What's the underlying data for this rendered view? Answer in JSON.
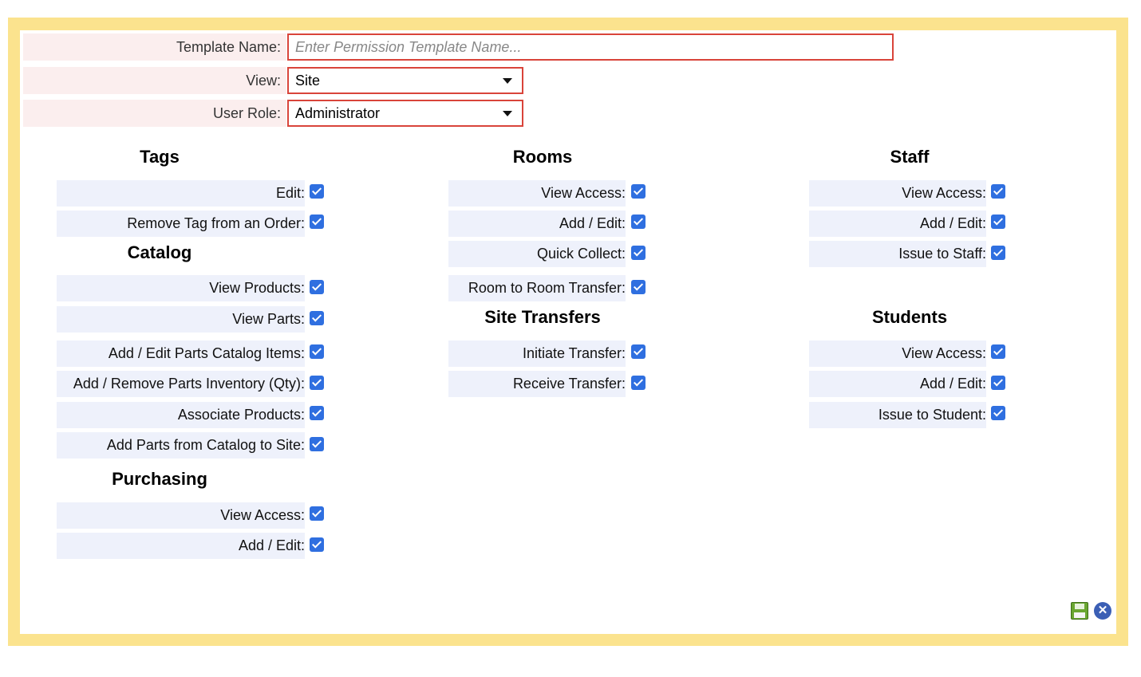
{
  "form": {
    "template_name": {
      "label": "Template Name:",
      "placeholder": "Enter Permission Template Name...",
      "value": ""
    },
    "view": {
      "label": "View:",
      "value": "Site"
    },
    "user_role": {
      "label": "User Role:",
      "value": "Administrator"
    }
  },
  "sections": {
    "tags": {
      "title": "Tags",
      "items": [
        {
          "label": "Edit:",
          "checked": true
        },
        {
          "label": "Remove Tag from an Order:",
          "checked": true
        }
      ]
    },
    "catalog": {
      "title": "Catalog",
      "items": [
        {
          "label": "View Products:",
          "checked": true
        },
        {
          "label": "View Parts:",
          "checked": true
        },
        {
          "label": "Add / Edit Parts Catalog Items:",
          "checked": true
        },
        {
          "label": "Add / Remove Parts Inventory (Qty):",
          "checked": true
        },
        {
          "label": "Associate Products:",
          "checked": true
        },
        {
          "label": "Add Parts from Catalog to Site:",
          "checked": true
        }
      ]
    },
    "purchasing": {
      "title": "Purchasing",
      "items": [
        {
          "label": "View Access:",
          "checked": true
        },
        {
          "label": "Add / Edit:",
          "checked": true
        }
      ]
    },
    "rooms": {
      "title": "Rooms",
      "items": [
        {
          "label": "View Access:",
          "checked": true
        },
        {
          "label": "Add / Edit:",
          "checked": true
        },
        {
          "label": "Quick Collect:",
          "checked": true
        },
        {
          "label": "Room to Room Transfer:",
          "checked": true
        }
      ]
    },
    "site_transfers": {
      "title": "Site Transfers",
      "items": [
        {
          "label": "Initiate Transfer:",
          "checked": true
        },
        {
          "label": "Receive Transfer:",
          "checked": true
        }
      ]
    },
    "staff": {
      "title": "Staff",
      "items": [
        {
          "label": "View Access:",
          "checked": true
        },
        {
          "label": "Add / Edit:",
          "checked": true
        },
        {
          "label": "Issue to Staff:",
          "checked": true
        }
      ]
    },
    "students": {
      "title": "Students",
      "items": [
        {
          "label": "View Access:",
          "checked": true
        },
        {
          "label": "Add / Edit:",
          "checked": true
        },
        {
          "label": "Issue to Student:",
          "checked": true
        }
      ]
    }
  },
  "colors": {
    "frame": "#fbe38e",
    "field_border": "#d9443a",
    "checkbox": "#2f6fe0",
    "row_bg": "#eef1fb"
  },
  "icons": {
    "save": "save-disk-icon",
    "close": "close-circle-icon"
  }
}
